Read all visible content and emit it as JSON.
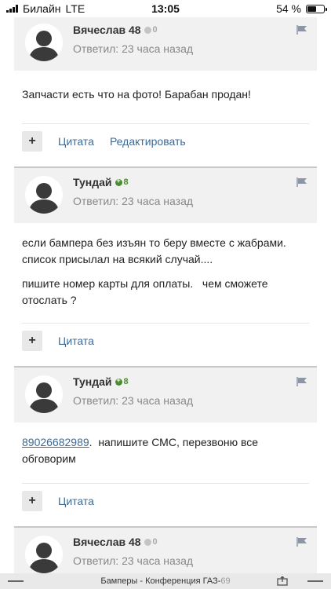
{
  "status_bar": {
    "carrier": "Билайн",
    "network": "LTE",
    "time": "13:05",
    "battery": "54 %",
    "battery_level": 0.54
  },
  "posts": [
    {
      "author": "Вячеслав 48",
      "reputation": "0",
      "reputation_type": "neutral",
      "meta": "Ответил: 23 часа назад",
      "paragraphs": [
        "Запчасти есть что на фото! Барабан продан!"
      ],
      "actions": [
        "Цитата",
        "Редактировать"
      ]
    },
    {
      "author": "Тундай",
      "reputation": "8",
      "reputation_type": "positive",
      "meta": "Ответил: 23 часа назад",
      "paragraphs": [
        "если бампера без изъян то беру вместе с жабрами. список присылал на всякий случай....",
        "пишите номер карты для оплаты.   чем сможете отослать ?"
      ],
      "actions": [
        "Цитата"
      ]
    },
    {
      "author": "Тундай",
      "reputation": "8",
      "reputation_type": "positive",
      "meta": "Ответил: 23 часа назад",
      "phone": "89026682989",
      "paragraphs_after_phone": ".  напишите СМС, перезвоню все обговорим",
      "actions": [
        "Цитата"
      ]
    },
    {
      "author": "Вячеслав 48",
      "reputation": "0",
      "reputation_type": "neutral",
      "meta": "Ответил: 23 часа назад"
    }
  ],
  "bottom_bar": {
    "title": "Бамперы - Конференция ГАЗ-69",
    "title_visible": "Бамперы - Конференция ГАЗ-",
    "title_faded": "69"
  },
  "colors": {
    "link": "#3d6a96",
    "positive": "#4a8c2f",
    "header_bg": "#f1f1f1"
  }
}
